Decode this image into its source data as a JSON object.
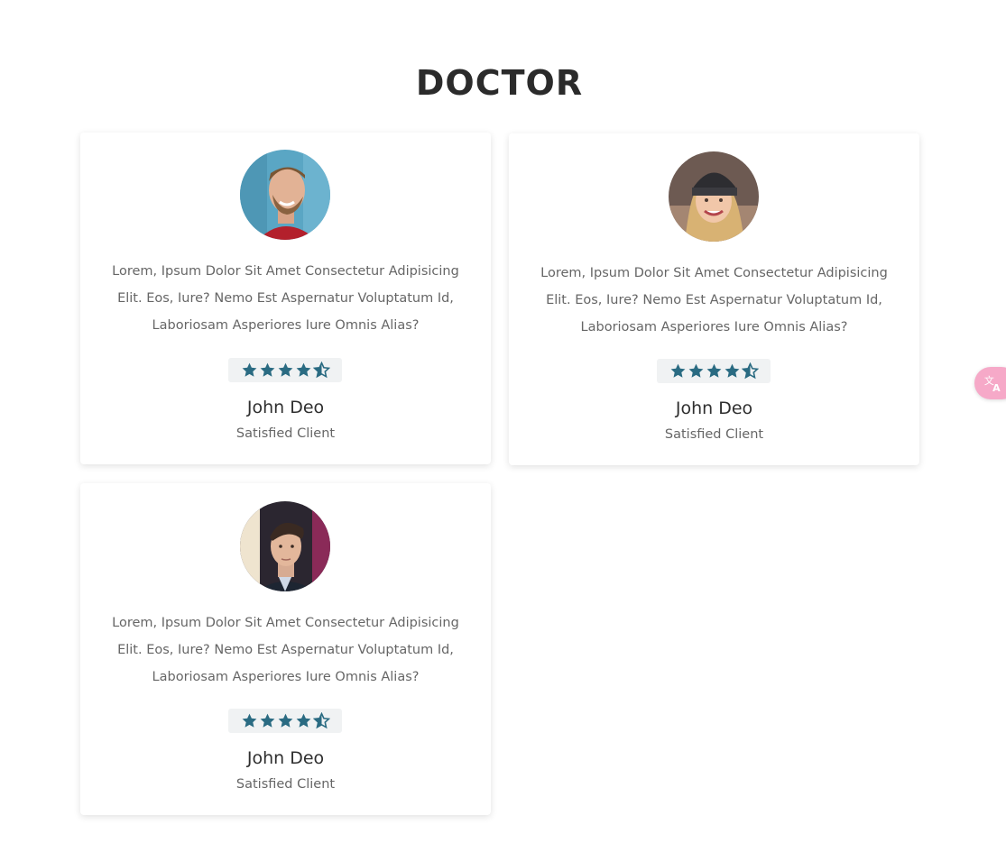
{
  "page": {
    "title": "DOCTOR"
  },
  "cards": [
    {
      "avatar_icon": "man-with-beard-avatar",
      "quote": "Lorem, Ipsum Dolor Sit Amet Consectetur Adipisicing Elit. Eos, Iure? Nemo Est Aspernatur Voluptatum Id, Laboriosam Asperiores Iure Omnis Alias?",
      "rating": 4.5,
      "name": "John Deo",
      "role": "Satisfied Client"
    },
    {
      "avatar_icon": "woman-with-beanie-avatar",
      "quote": "Lorem, Ipsum Dolor Sit Amet Consectetur Adipisicing Elit. Eos, Iure? Nemo Est Aspernatur Voluptatum Id, Laboriosam Asperiores Iure Omnis Alias?",
      "rating": 4.5,
      "name": "John Deo",
      "role": "Satisfied Client"
    },
    {
      "avatar_icon": "man-portrait-avatar",
      "quote": "Lorem, Ipsum Dolor Sit Amet Consectetur Adipisicing Elit. Eos, Iure? Nemo Est Aspernatur Voluptatum Id, Laboriosam Asperiores Iure Omnis Alias?",
      "rating": 4.5,
      "name": "John Deo",
      "role": "Satisfied Client"
    }
  ],
  "colors": {
    "star": "#2a6b82",
    "rating_bg": "#f0f2f3",
    "translate_button": "#f6a9c8"
  },
  "widgets": {
    "translate_icon": "translate-icon"
  }
}
